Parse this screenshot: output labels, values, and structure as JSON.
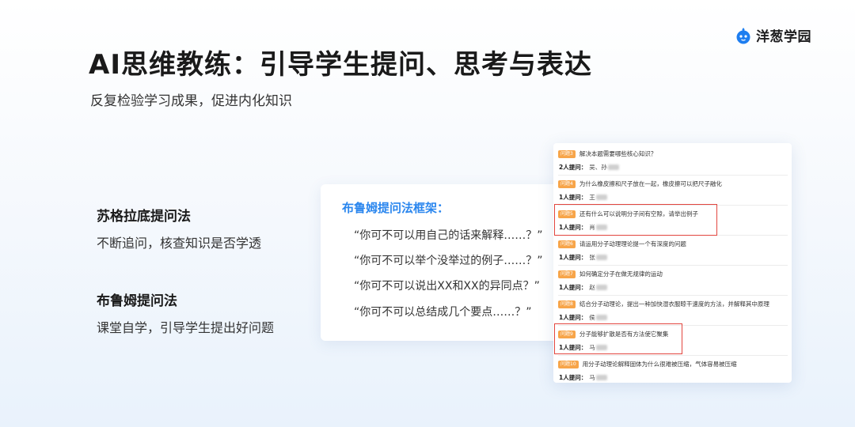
{
  "brand": {
    "name": "洋葱学园",
    "color": "#1e7ef0"
  },
  "header": {
    "title": "AI思维教练：引导学生提问、思考与表达",
    "subtitle": "反复检验学习成果，促进内化知识"
  },
  "methods": [
    {
      "name": "苏格拉底提问法",
      "desc": "不断追问，核查知识是否学透"
    },
    {
      "name": "布鲁姆提问法",
      "desc": "课堂自学，引导学生提出好问题"
    }
  ],
  "bloom": {
    "heading": "布鲁姆提问法框架：",
    "questions": [
      "“你可不可以用自己的话来解释……？”",
      "“你可不可以举个没举过的例子……？”",
      "“你可不可以说出XX和XX的异同点？”",
      "“你可不可以总结成几个要点……？”"
    ]
  },
  "question_list": {
    "items": [
      {
        "badge": "问题3",
        "text": "解决本题需要哪些核心知识？",
        "count": "2人提问：",
        "names": "吴、孙"
      },
      {
        "badge": "问题4",
        "text": "为什么橡皮擦和尺子放在一起，橡皮擦可以把尺子融化",
        "count": "1人提问：",
        "names": "王"
      },
      {
        "badge": "问题5",
        "text": "还有什么可以说明分子间有空隙，请举出例子",
        "count": "1人提问：",
        "names": "肖"
      },
      {
        "badge": "问题6",
        "text": "请运用分子动理理论提一个有深度的问题",
        "count": "1人提问：",
        "names": "张"
      },
      {
        "badge": "问题7",
        "text": "如何确定分子在做无规律的运动",
        "count": "1人提问：",
        "names": "赵"
      },
      {
        "badge": "问题8",
        "text": "结合分子动理论，提出一种加快湿衣服晾干速度的方法，并解释其中原理",
        "count": "1人提问：",
        "names": "侯"
      },
      {
        "badge": "问题9",
        "text": "分子能够扩散是否有方法使它聚集",
        "count": "1人提问：",
        "names": "马"
      },
      {
        "badge": "问题10",
        "text": "用分子动理论解释固体为什么很难被压缩，气体容易被压缩",
        "count": "1人提问：",
        "names": "马"
      }
    ],
    "highlight_color": "#e2463f",
    "badge_color": "#f7a54a"
  }
}
